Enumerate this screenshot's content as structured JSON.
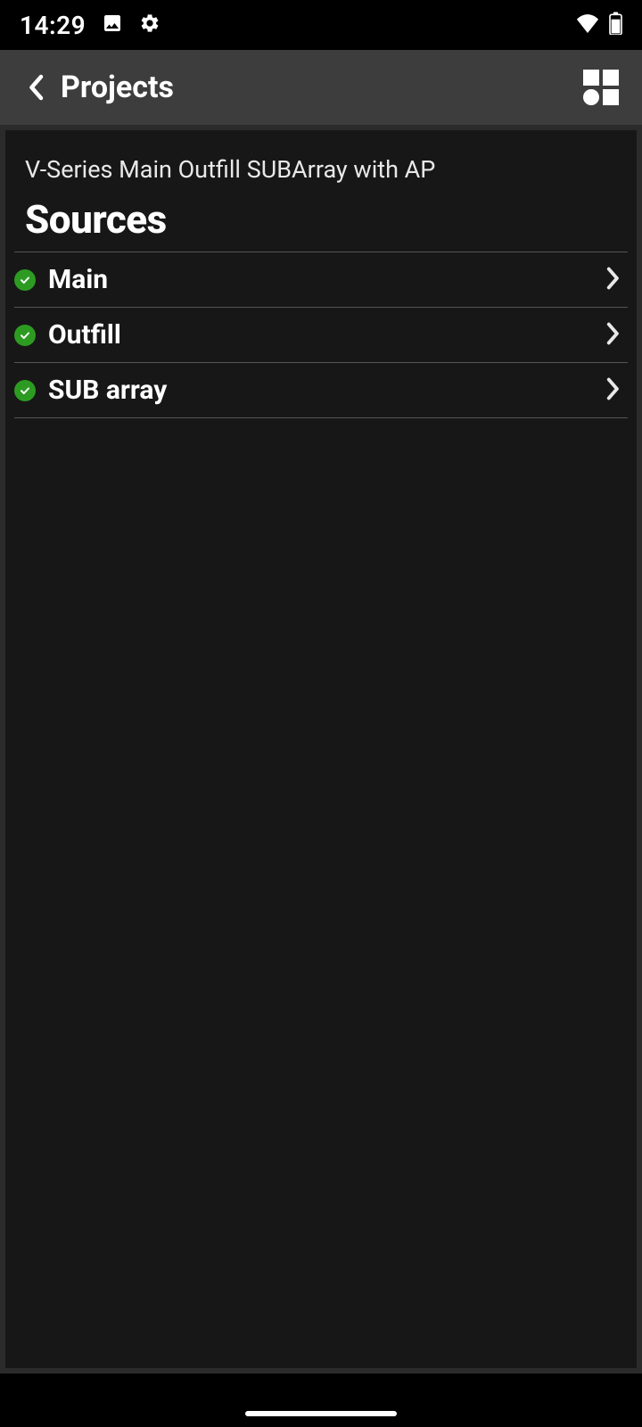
{
  "statusbar": {
    "time": "14:29"
  },
  "appbar": {
    "title": "Projects"
  },
  "project": {
    "subtitle": "V-Series Main Outfill SUBArray with AP",
    "section_heading": "Sources",
    "items": [
      {
        "label": "Main"
      },
      {
        "label": "Outfill"
      },
      {
        "label": "SUB array"
      }
    ]
  }
}
